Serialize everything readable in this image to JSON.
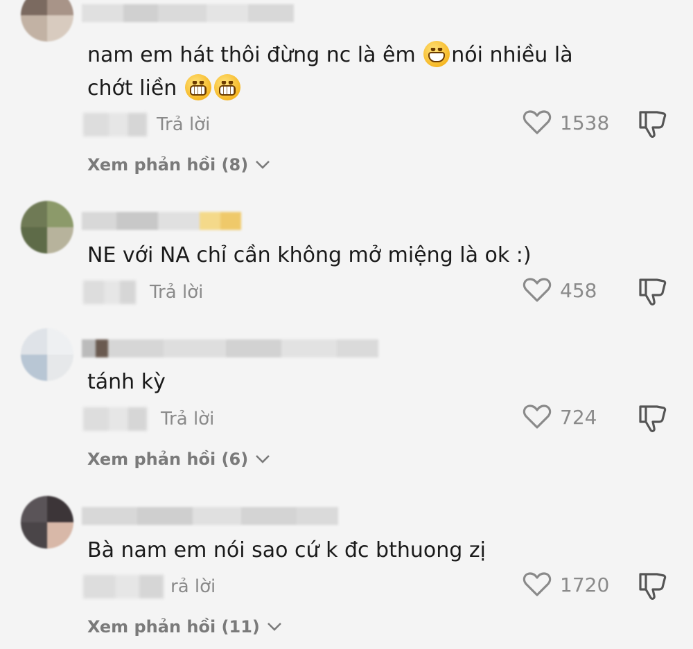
{
  "comments": [
    {
      "text_parts": [
        "nam em hát thôi đừng nc là êm ",
        "nói nhiều là"
      ],
      "text_line2": "chớt liền",
      "reply_label": "Trả lời",
      "likes": "1538",
      "view_replies": "Xem phản hồi (8)"
    },
    {
      "text": "NE với NA chỉ cần không mở miệng là ok :)",
      "reply_label": "Trả lời",
      "likes": "458"
    },
    {
      "text": "tánh kỳ",
      "reply_label": "Trả lời",
      "likes": "724",
      "view_replies": "Xem phản hồi (6)"
    },
    {
      "text": "Bà nam em nói sao cứ k đc bthuong zị",
      "reply_label": "rả lời",
      "likes": "1720",
      "view_replies": "Xem phản hồi (11)"
    }
  ],
  "icons": {
    "like": "heart-outline-icon",
    "dislike": "thumbs-down-outline-icon",
    "expand": "chevron-down-icon",
    "emoji_grin": "grinning-face-emoji",
    "emoji_grimace": "grimacing-face-emoji"
  },
  "colors": {
    "background": "#f4f4f4",
    "text": "#1a1a1a",
    "muted": "#8a8a8a"
  }
}
